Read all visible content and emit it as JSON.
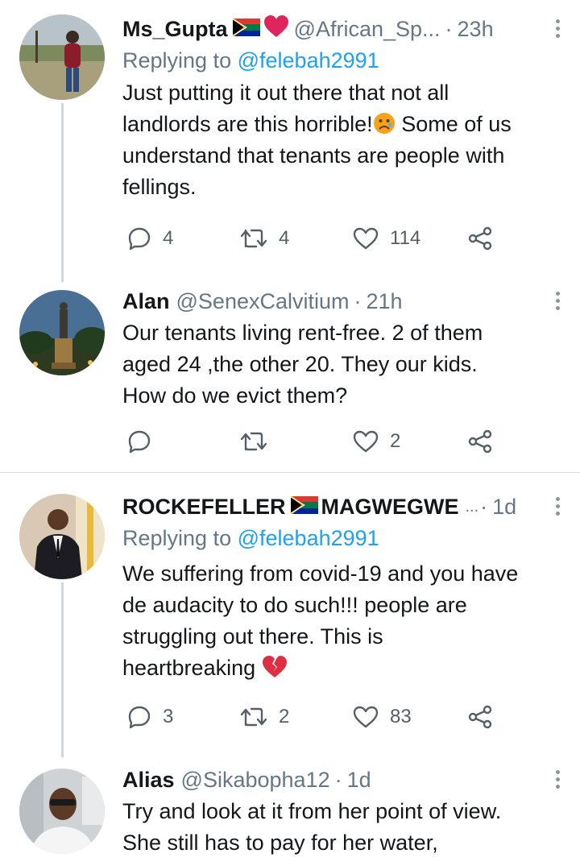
{
  "tweets": [
    {
      "name": "Ms_Gupta",
      "handle": "@African_Sp...",
      "time": "23h",
      "replying_label": "Replying to",
      "replying_to": "@felebah2991",
      "text_lines": [
        "Just putting it out there that not all",
        "landlords are this horrible!",
        "Some of us",
        "understand that tenants are people with",
        "fellings."
      ],
      "replies": "4",
      "retweets": "4",
      "likes": "114"
    },
    {
      "name": "Alan",
      "handle": "@SenexCalvitium",
      "time": "21h",
      "text_lines": [
        "Our tenants living rent-free. 2 of them",
        "aged 24 ,the other 20. They our kids.",
        "How do we evict them?"
      ],
      "replies": "",
      "retweets": "",
      "likes": "2"
    },
    {
      "name_part1": "ROCKEFELLER",
      "name_part2": "MAGWEGWE",
      "name_trunc": "...",
      "time": "1d",
      "replying_label": "Replying to",
      "replying_to": "@felebah2991",
      "text_lines": [
        "We suffering from covid-19 and you have",
        "de  audacity to do such!!! people are",
        "struggling out there. This is",
        "heartbreaking"
      ],
      "replies": "3",
      "retweets": "2",
      "likes": "83"
    },
    {
      "name": "Alias",
      "handle": "@Sikabopha12",
      "time": "1d",
      "text_lines": [
        "Try and look at it from her point of view.",
        "She still has to pay for her water,"
      ]
    }
  ],
  "separator": "·",
  "icons": {
    "reply": "reply-icon",
    "retweet": "retweet-icon",
    "like": "heart-icon",
    "share": "share-icon",
    "more": "more-vertical-icon",
    "flag": "south-africa-flag",
    "emoji_sad": "sad-face-emoji",
    "emoji_heart": "broken-heart-emoji"
  },
  "colors": {
    "link": "#1da1f2",
    "secondary_text": "#657786",
    "primary_text": "#14171a",
    "thread_line": "#cfd9de",
    "flag_heart": "#e0245e"
  }
}
